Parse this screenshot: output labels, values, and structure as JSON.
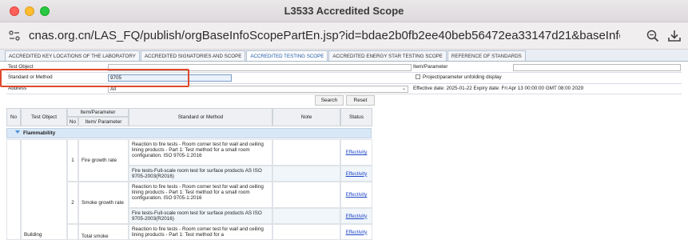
{
  "window": {
    "title": "L3533 Accredited Scope",
    "url": "cnas.org.cn/LAS_FQ/publish/orgBaseInfoScopePartEn.jsp?id=bdae2b0fb2ee40beb56472ea33147d21&baseInfoId=0527805407..."
  },
  "tabs": [
    {
      "label": "ACCREDITED KEY LOCATIONS OF THE LABORATORY",
      "active": false
    },
    {
      "label": "ACCREDITED SIGNATORIES AND SCOPE",
      "active": false
    },
    {
      "label": "ACCREDITED TESTING SCOPE",
      "active": true
    },
    {
      "label": "ACCREDITED ENERGY STAR TESTING SCOPE",
      "active": false
    },
    {
      "label": "REFERENCE OF STANDARDS",
      "active": false
    }
  ],
  "form": {
    "test_object_label": "Test Object",
    "test_object_value": "",
    "item_parameter_label": "Item/Parameter",
    "item_parameter_value": "",
    "standard_label": "Standard or Method",
    "standard_value": "9705",
    "unfold_label": "Project/parameter unfolding display",
    "unfold_checked": false,
    "address_label": "Address",
    "address_value": "All",
    "dates": "Effective date: 2025-01-22 Expiry date: Fri Apr 13 00:00:00 GMT 08:00 2029",
    "search_button": "Search",
    "reset_button": "Reset"
  },
  "table": {
    "headers": {
      "no": "No",
      "test_object": "Test Object",
      "item_parameter": "Item/Parameter",
      "sub_no": "No",
      "sub_item": "Item/ Parameter",
      "standard": "Standard or Method",
      "note": "Note",
      "status": "Status"
    },
    "group": "Flammability",
    "test_object_cell": "Building",
    "rows": [
      {
        "no": "1",
        "item": "Fire growth rate",
        "standards": [
          {
            "text": "Reaction to fire tests - Room corner test for wall and ceiling lining products - Part 1: Test method for a small room configuration. ISO 9705-1:2016",
            "status": "Effectivity"
          },
          {
            "text": "Fire tests-Full-scale room test for surface products AS ISO 9705-2003(R2016)",
            "status": "Effectivity"
          }
        ]
      },
      {
        "no": "2",
        "item": "Smoke growth rate",
        "standards": [
          {
            "text": "Reaction to fire tests - Room corner test for wall and ceiling lining products - Part 1: Test method for a small room configuration. ISO 9705-1:2016",
            "status": "Effectivity"
          },
          {
            "text": "Fire tests-Full-scale room test for surface products AS ISO 9705-2003(R2016)",
            "status": "Effectivity"
          }
        ]
      },
      {
        "no": "",
        "item": "Total smoke",
        "standards": [
          {
            "text": "Reaction to fire tests - Room corner test for wall and ceiling lining products - Part 1: Test method for a",
            "status": "Effectivity"
          }
        ]
      }
    ]
  }
}
